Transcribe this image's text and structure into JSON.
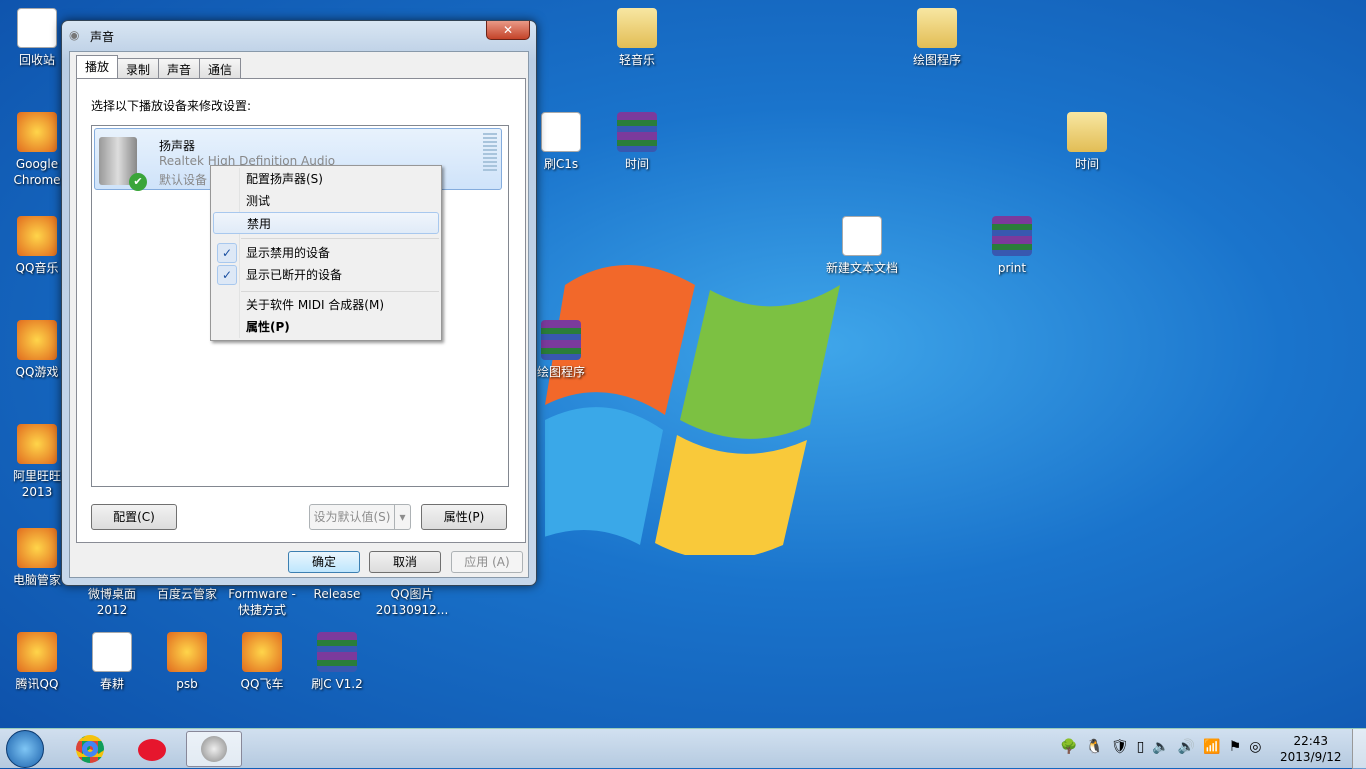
{
  "desktop": {
    "icons": [
      {
        "label": "回收站",
        "x": 0,
        "y": 8,
        "kind": "doc"
      },
      {
        "label": "Google Chrome",
        "kind": "app"
      },
      {
        "label": "QQ音乐",
        "kind": "app"
      },
      {
        "label": "QQ游戏",
        "kind": "app"
      },
      {
        "label": "阿里旺旺 2013",
        "kind": "app"
      },
      {
        "label": "电脑管家",
        "kind": "app"
      },
      {
        "label": "腾讯QQ",
        "kind": "app"
      },
      {
        "label": "春耕",
        "kind": "doc"
      },
      {
        "label": "psb",
        "kind": "app"
      },
      {
        "label": "QQ飞车",
        "kind": "app"
      },
      {
        "label": "刷C V1.2",
        "kind": "rar"
      },
      {
        "label": "轻音乐",
        "kind": "folder"
      },
      {
        "label": "绘图程序",
        "kind": "folder"
      },
      {
        "label": "刷C1s",
        "kind": "doc"
      },
      {
        "label": "时间",
        "kind": "rar"
      },
      {
        "label": "时间",
        "kind": "folder"
      },
      {
        "label": "新建文本文档",
        "kind": "doc"
      },
      {
        "label": "print",
        "kind": "rar"
      },
      {
        "label": "绘图程序",
        "kind": "rar"
      }
    ],
    "partial_labels": [
      "微博桌面 2012",
      "百度云管家",
      "Formware - 快捷方式",
      "Release",
      "QQ图片 20130912..."
    ]
  },
  "dialog": {
    "title": "声音",
    "close": "✕",
    "tabs": [
      "播放",
      "录制",
      "声音",
      "通信"
    ],
    "instruction": "选择以下播放设备来修改设置:",
    "device": {
      "name": "扬声器",
      "driver": "Realtek High Definition Audio",
      "status": "默认设备"
    },
    "buttons": {
      "configure": "配置(C)",
      "set_default": "设为默认值(S)",
      "properties": "属性(P)",
      "ok": "确定",
      "cancel": "取消",
      "apply": "应用 (A)"
    }
  },
  "context_menu": {
    "items": [
      "配置扬声器(S)",
      "测试",
      "禁用",
      "显示禁用的设备",
      "显示已断开的设备",
      "关于软件 MIDI 合成器(M)",
      "属性(P)"
    ],
    "highlighted": "禁用",
    "checked": [
      "显示禁用的设备",
      "显示已断开的设备"
    ]
  },
  "taskbar": {
    "pinned": [
      "start-button",
      "chrome",
      "weibo",
      "sound"
    ],
    "tray": [
      "tree-icon",
      "qq-icon",
      "shield-icon",
      "battery-icon",
      "volume-icon",
      "speaker-icon",
      "signal-icon",
      "flag-icon",
      "network-icon"
    ],
    "time": "22:43",
    "date": "2013/9/12"
  }
}
